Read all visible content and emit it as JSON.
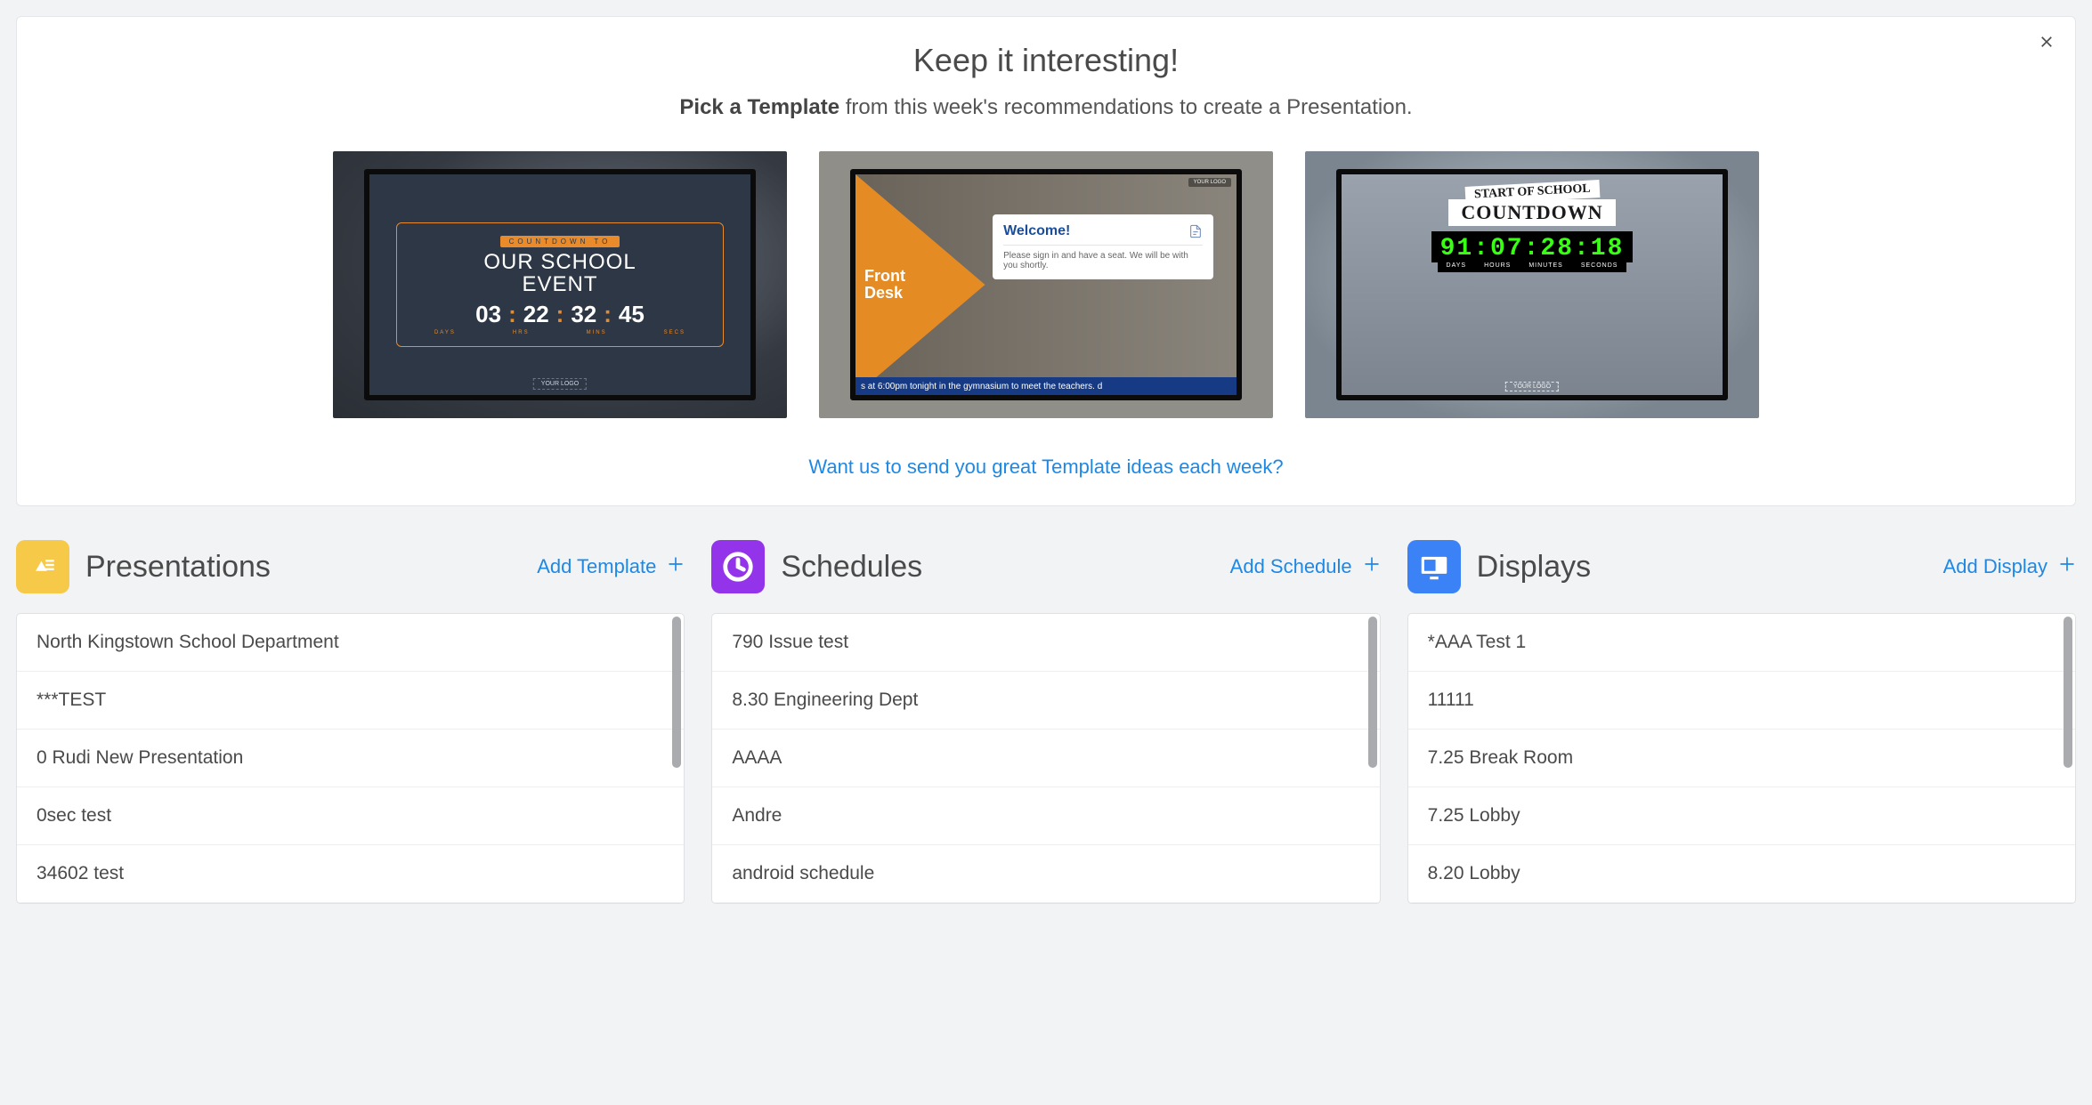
{
  "hero": {
    "title": "Keep it interesting!",
    "subtitle_strong": "Pick a Template",
    "subtitle_rest": " from this week's recommendations to create a Presentation.",
    "footer_link": "Want us to send you great Template ideas each week?"
  },
  "templates": [
    {
      "top_label": "COUNTDOWN TO",
      "title_line1": "OUR SCHOOL",
      "title_line2": "EVENT",
      "digits": [
        "03",
        "22",
        "32",
        "45"
      ],
      "unit_labels": [
        "DAYS",
        "HRS",
        "MINS",
        "SECS"
      ],
      "logo": "YOUR LOGO"
    },
    {
      "logo": "YOUR LOGO",
      "triangle_text": "Front\nDesk",
      "card_title": "Welcome!",
      "card_body": "Please sign in and have a seat. We will be with you shortly.",
      "ticker": "s at 6:00pm tonight in the gymnasium to meet the teachers. d"
    },
    {
      "banner1": "START OF SCHOOL",
      "banner2": "COUNTDOWN",
      "led": "91:07:28:18",
      "unit_labels": [
        "DAYS",
        "HOURS",
        "MINUTES",
        "SECONDS"
      ],
      "logo": "YOUR LOGO"
    }
  ],
  "columns": {
    "presentations": {
      "title": "Presentations",
      "add_label": "Add Template",
      "items": [
        "North Kingstown School Department",
        "***TEST",
        "0 Rudi New Presentation",
        "0sec test",
        "34602 test"
      ]
    },
    "schedules": {
      "title": "Schedules",
      "add_label": "Add Schedule",
      "items": [
        "790 Issue test",
        "8.30 Engineering Dept",
        "AAAA",
        "Andre",
        "android schedule"
      ]
    },
    "displays": {
      "title": "Displays",
      "add_label": "Add Display",
      "items": [
        "*AAA Test 1",
        "11111",
        "7.25 Break Room",
        "7.25 Lobby",
        "8.20 Lobby"
      ]
    }
  }
}
